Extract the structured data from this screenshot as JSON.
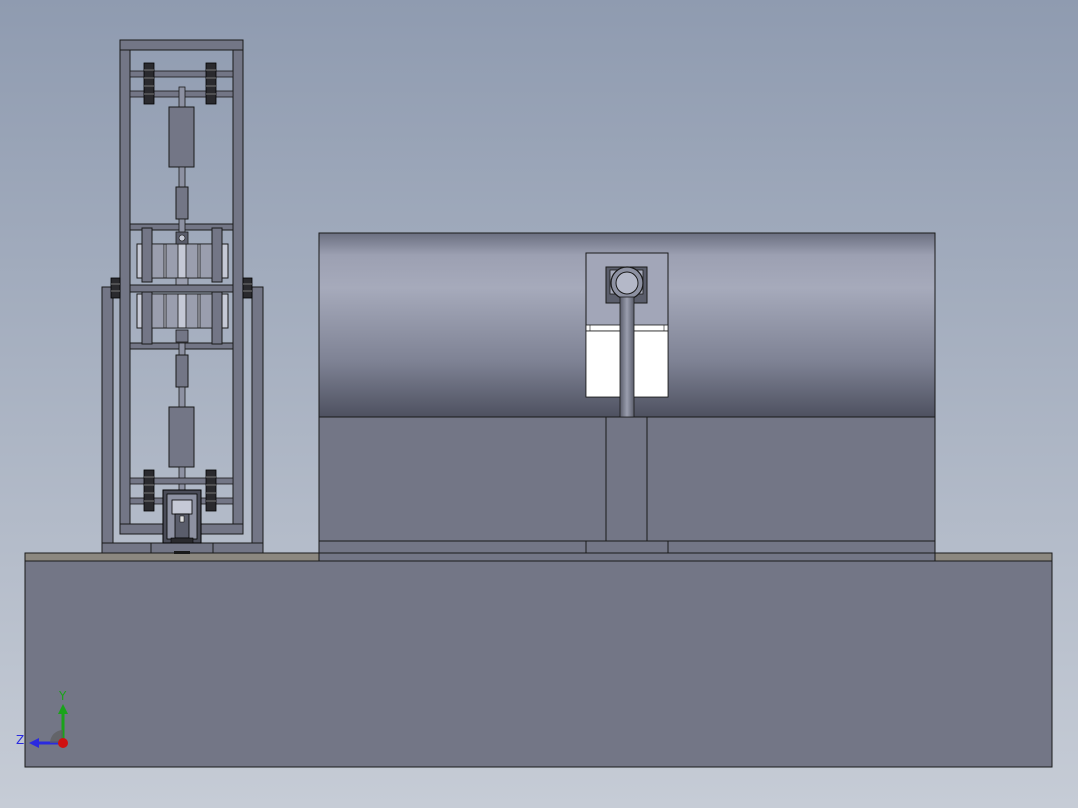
{
  "triad": {
    "y_label": "Y",
    "z_label": "Z",
    "y_color": "#1aa31a",
    "z_color": "#2a2ae0",
    "x_color": "#d01010"
  },
  "colors": {
    "background_top": "#8f9bb0",
    "background_bottom": "#c6ccd6",
    "part_fill": "#737686",
    "edge": "#1a1a1a"
  }
}
